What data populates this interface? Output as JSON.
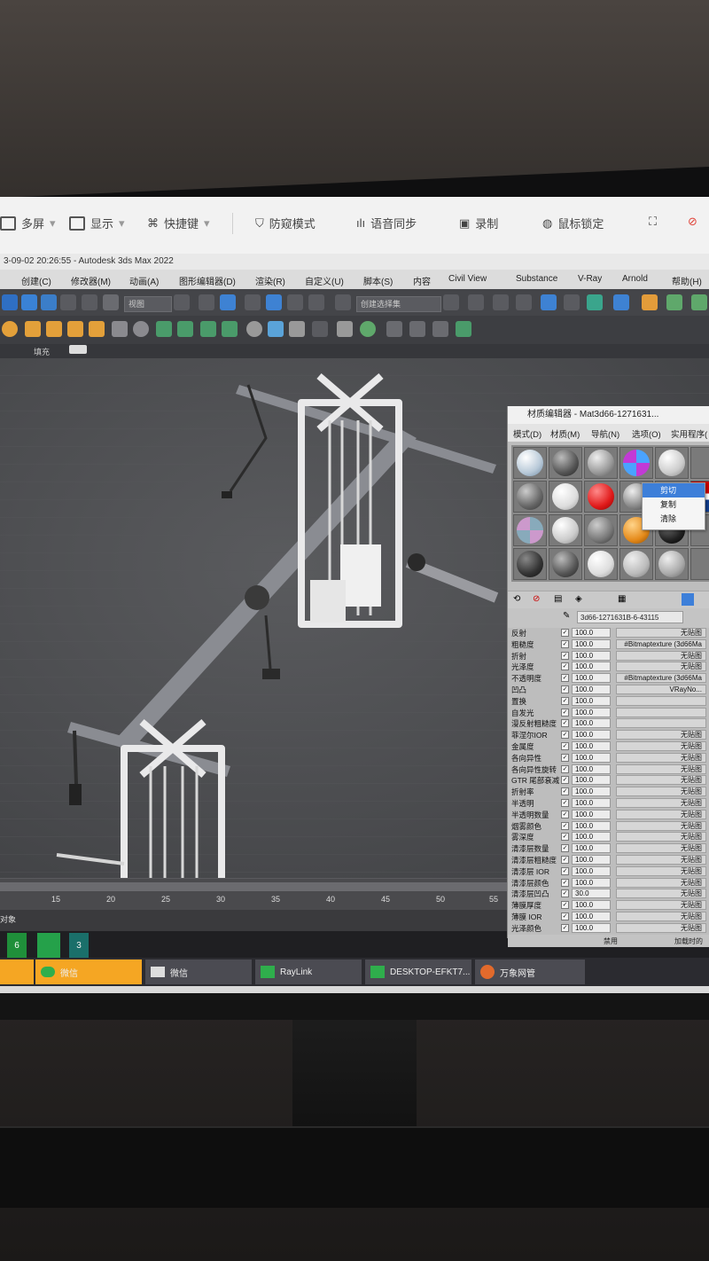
{
  "remote_bar": {
    "items": [
      "多屏",
      "显示",
      "快捷键",
      "防窥模式",
      "语音同步",
      "录制",
      "鼠标锁定"
    ]
  },
  "window_title": "3-09-02 20:26:55 - Autodesk 3ds Max 2022",
  "menu": [
    "创建(C)",
    "修改器(M)",
    "动画(A)",
    "图形编辑器(D)",
    "渲染(R)",
    "自定义(U)",
    "脚本(S)",
    "内容",
    "Civil View",
    "Substance",
    "V-Ray",
    "Arnold",
    "帮助(H)"
  ],
  "toolbar": {
    "view_dropdown": "视图",
    "selection_set": "创建选择集"
  },
  "ribbon": {
    "label": "填充"
  },
  "timeline": {
    "ticks": [
      "15",
      "20",
      "25",
      "30",
      "35",
      "40",
      "45",
      "50",
      "55"
    ]
  },
  "status": {
    "text": "对象"
  },
  "taskbar": {
    "top_badges": [
      "6",
      "3"
    ],
    "apps": [
      "微信",
      "微信",
      "RayLink",
      "DESKTOP-EFKT7...",
      "万象网管"
    ]
  },
  "material_editor": {
    "title": "材质编辑器 - Mat3d66-1271631...",
    "menu": [
      "模式(D)",
      "材质(M)",
      "导航(N)",
      "选项(O)",
      "实用程序("
    ],
    "material_name": "3d66-1271631B-6-43115",
    "rows": [
      {
        "label": "反射",
        "value": "100.0",
        "map": "无贴图"
      },
      {
        "label": "粗糙度",
        "value": "100.0",
        "map": "#Bitmaptexture (3d66Ma"
      },
      {
        "label": "折射",
        "value": "100.0",
        "map": "无贴图"
      },
      {
        "label": "光泽度",
        "value": "100.0",
        "map": "无贴图"
      },
      {
        "label": "不透明度",
        "value": "100.0",
        "map": "#Bitmaptexture (3d66Ma"
      },
      {
        "label": "凹凸",
        "value": "100.0",
        "map": "VRayNo..."
      },
      {
        "label": "置换",
        "value": "100.0",
        "map": ""
      },
      {
        "label": "自发光",
        "value": "100.0",
        "map": ""
      },
      {
        "label": "漫反射粗糙度",
        "value": "100.0",
        "map": ""
      },
      {
        "label": "菲涅尔IOR",
        "value": "100.0",
        "map": "无贴图"
      },
      {
        "label": "金属度",
        "value": "100.0",
        "map": "无贴图"
      },
      {
        "label": "各向异性",
        "value": "100.0",
        "map": "无贴图"
      },
      {
        "label": "各向异性旋转",
        "value": "100.0",
        "map": "无贴图"
      },
      {
        "label": "GTR 尾部衰减",
        "value": "100.0",
        "map": "无贴图"
      },
      {
        "label": "折射率",
        "value": "100.0",
        "map": "无贴图"
      },
      {
        "label": "半透明",
        "value": "100.0",
        "map": "无贴图"
      },
      {
        "label": "半透明数量",
        "value": "100.0",
        "map": "无贴图"
      },
      {
        "label": "烟雾颜色",
        "value": "100.0",
        "map": "无贴图"
      },
      {
        "label": "雾深度",
        "value": "100.0",
        "map": "无贴图"
      },
      {
        "label": "清漆层数量",
        "value": "100.0",
        "map": "无贴图"
      },
      {
        "label": "清漆层粗糙度",
        "value": "100.0",
        "map": "无贴图"
      },
      {
        "label": "清漆层 IOR",
        "value": "100.0",
        "map": "无贴图"
      },
      {
        "label": "清漆层颜色",
        "value": "100.0",
        "map": "无贴图"
      },
      {
        "label": "清漆层凹凸",
        "value": "30.0",
        "map": "无贴图"
      },
      {
        "label": "薄膜厚度",
        "value": "100.0",
        "map": "无贴图"
      },
      {
        "label": "薄膜 IOR",
        "value": "100.0",
        "map": "无贴图"
      },
      {
        "label": "光泽颜色",
        "value": "100.0",
        "map": "无贴图"
      }
    ],
    "context_menu": [
      "剪切",
      "复制",
      "清除"
    ],
    "footer": [
      "禁用",
      "加载时的"
    ]
  },
  "colors": {
    "accent_blue": "#3d7fd9",
    "taskbar_orange": "#f5a623",
    "viewport_gray": "#4a4b4e"
  }
}
